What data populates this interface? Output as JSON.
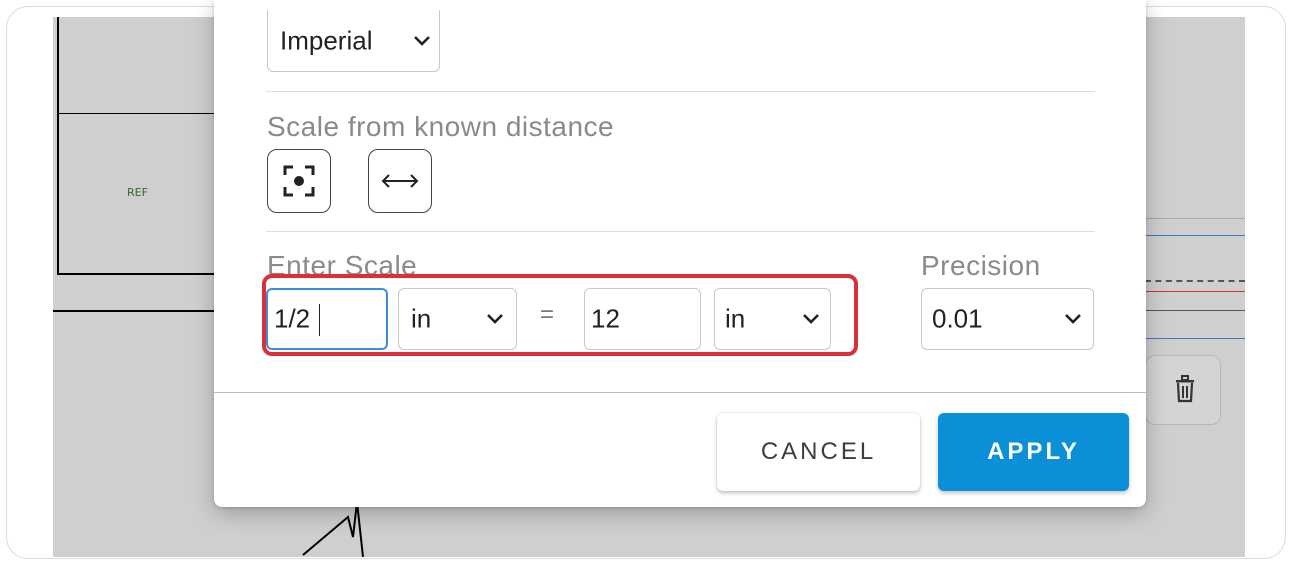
{
  "canvas": {
    "ref_label": "REF"
  },
  "modal": {
    "unit_system": {
      "selected": "Imperial"
    },
    "known_distance": {
      "label": "Scale from known distance",
      "buttons": [
        {
          "name": "target-scale-tool",
          "icon": "focus-target-icon"
        },
        {
          "name": "measure-distance-tool",
          "icon": "horizontal-arrows-icon"
        }
      ]
    },
    "enter_scale": {
      "label": "Enter Scale",
      "paper_value": "1/2",
      "paper_unit": "in",
      "equals": "=",
      "real_value": "12",
      "real_unit": "in"
    },
    "precision": {
      "label": "Precision",
      "selected": "0.01"
    },
    "footer": {
      "cancel_label": "CANCEL",
      "apply_label": "APPLY"
    }
  },
  "colors": {
    "accent": "#0b8fd6",
    "highlight": "#d8313a",
    "focus": "#3a8fdb"
  }
}
